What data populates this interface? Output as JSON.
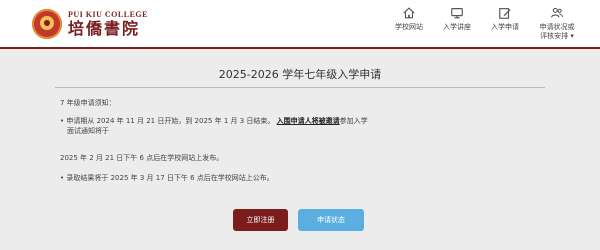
{
  "header": {
    "logo_en": "PUI KIU COLLEGE",
    "logo_zh": "培僑書院",
    "nav": [
      {
        "label": "学校网站",
        "icon": "home-icon"
      },
      {
        "label": "入学讲座",
        "icon": "monitor-icon"
      },
      {
        "label": "入学申请",
        "icon": "edit-icon"
      },
      {
        "label": "申请状况或\n评核安排",
        "icon": "people-icon"
      }
    ],
    "caret": "▾"
  },
  "main": {
    "title": "2025-2026 学年七年级入学申请",
    "notice_heading": "7 年级申请须知：",
    "bullet1_prefix": "• 申请期从 2024 年 11 月 21 日开始，到 2025 年 1 月 3 日结束。",
    "bullet1_link": "入围申请人将被邀请",
    "bullet1_suffix": "参加入学",
    "bullet1_line2": "面试通知将于",
    "line_date": "2025 年 2 月 21 日下午 6 点后在学校网站上发布。",
    "bullet2": "• 录取结果将于 2025 年 3 月 17 日下午 6 点后在学校网站上公布。",
    "register_button": "立即注册",
    "status_button": "申请状态"
  },
  "colors": {
    "brand": "#7a1f1f",
    "status_button": "#5aaee0",
    "background": "#ececec"
  }
}
